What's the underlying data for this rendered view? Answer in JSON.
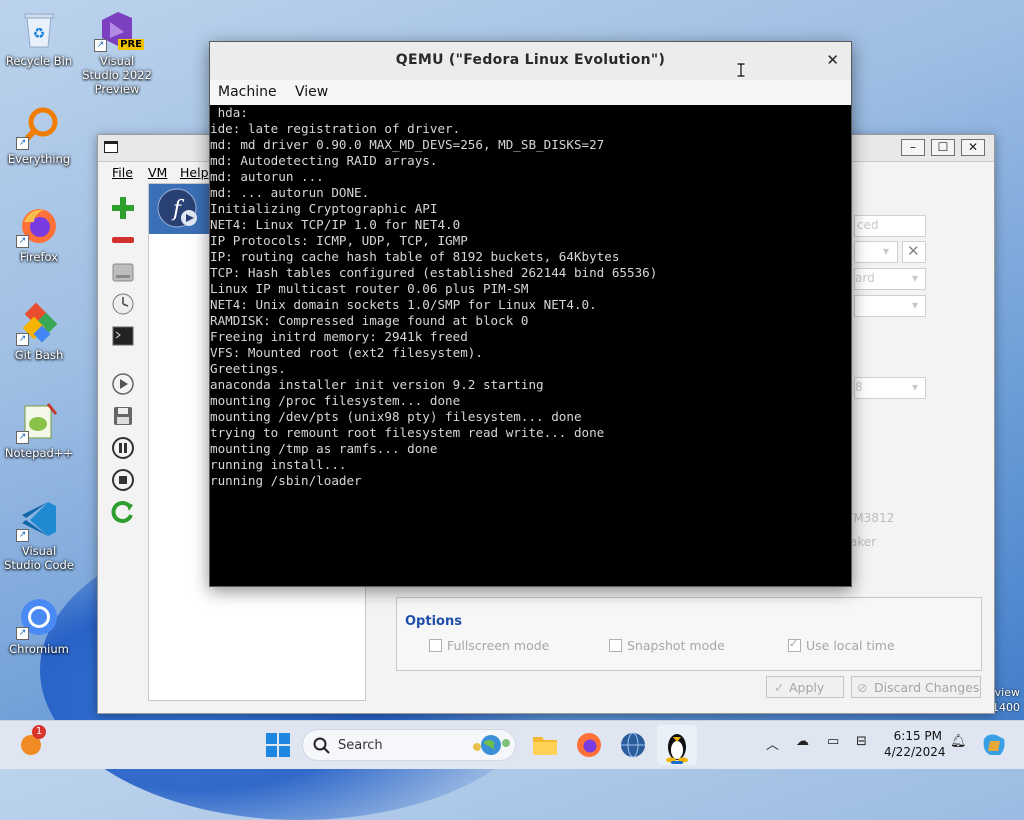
{
  "desktop": {
    "icons": [
      {
        "label": "Recycle Bin"
      },
      {
        "label": "Visual Studio 2022 Preview",
        "badge": "PRE"
      },
      {
        "label": "Everything"
      },
      {
        "label": "Firefox"
      },
      {
        "label": "Git Bash"
      },
      {
        "label": "Notepad++"
      },
      {
        "label": "Visual Studio Code"
      },
      {
        "label": "Chromium"
      }
    ],
    "edge_fragment_1": "view",
    "edge_fragment_2": "1400"
  },
  "manager": {
    "menu": {
      "file": "File",
      "vm": "VM",
      "help": "Help"
    },
    "ghost_texts": {
      "advanced": "ced",
      "standard": "ard",
      "ram": "8",
      "cpu": "YM3812",
      "speaker": "aker"
    },
    "options": {
      "title": "Options",
      "fullscreen": "Fullscreen mode",
      "snapshot": "Snapshot mode",
      "localtime": "Use local time"
    },
    "apply_label": "Apply",
    "discard_label": "Discard Changes"
  },
  "qemu": {
    "title": "QEMU (\"Fedora Linux Evolution\")",
    "menu": {
      "machine": "Machine",
      "view": "View"
    },
    "console_lines": [
      " hda:",
      "ide: late registration of driver.",
      "md: md driver 0.90.0 MAX_MD_DEVS=256, MD_SB_DISKS=27",
      "md: Autodetecting RAID arrays.",
      "md: autorun ...",
      "md: ... autorun DONE.",
      "Initializing Cryptographic API",
      "NET4: Linux TCP/IP 1.0 for NET4.0",
      "IP Protocols: ICMP, UDP, TCP, IGMP",
      "IP: routing cache hash table of 8192 buckets, 64Kbytes",
      "TCP: Hash tables configured (established 262144 bind 65536)",
      "Linux IP multicast router 0.06 plus PIM-SM",
      "NET4: Unix domain sockets 1.0/SMP for Linux NET4.0.",
      "RAMDISK: Compressed image found at block 0",
      "Freeing initrd memory: 2941k freed",
      "VFS: Mounted root (ext2 filesystem).",
      "Greetings.",
      "anaconda installer init version 9.2 starting",
      "mounting /proc filesystem... done",
      "mounting /dev/pts (unix98 pty) filesystem... done",
      "trying to remount root filesystem read write... done",
      "mounting /tmp as ramfs... done",
      "running install...",
      "running /sbin/loader"
    ]
  },
  "taskbar": {
    "search_placeholder": "Search",
    "notification_count": "1",
    "time": "6:15 PM",
    "date": "4/22/2024"
  }
}
